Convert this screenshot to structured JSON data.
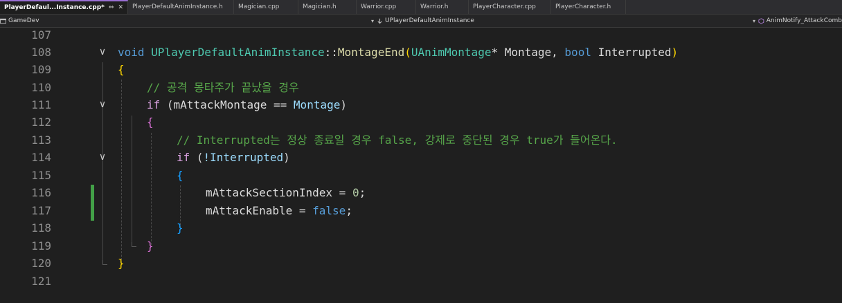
{
  "tabs": [
    {
      "label": "PlayerDefaul...Instance.cpp*",
      "active": true,
      "pin": "⇔",
      "close": "✕"
    },
    {
      "label": "PlayerDefaultAnimInstance.h"
    },
    {
      "label": "Magician.cpp"
    },
    {
      "label": "Magician.h"
    },
    {
      "label": "Warrior.cpp"
    },
    {
      "label": "Warrior.h"
    },
    {
      "label": "PlayerCharacter.cpp"
    },
    {
      "label": "PlayerCharacter.h"
    }
  ],
  "navbar": {
    "project": "GameDev",
    "scope": "UPlayerDefaultAnimInstance",
    "member": "AnimNotify_AttackComb"
  },
  "editor": {
    "line_numbers": [
      "107",
      "108",
      "109",
      "110",
      "111",
      "112",
      "113",
      "114",
      "115",
      "116",
      "117",
      "118",
      "119",
      "120",
      "121"
    ],
    "code": {
      "l108": {
        "void": "void",
        "cls": "UPlayerDefaultAnimInstance",
        "sep": "::",
        "fn": "MontageEnd",
        "p1": "(",
        "ptype": "UAnimMontage",
        "star": "* Montage, ",
        "bool": "bool",
        "rest": " Interrupted",
        "p2": ")"
      },
      "l109": "{",
      "l110": "// 공격 몽타주가 끝났을 경우",
      "l111": {
        "kw": "if",
        "open": " (",
        "var": "mAttackMontage",
        "op": " == ",
        "arg": "Montage",
        "close": ")"
      },
      "l112": "{",
      "l113": "// Interrupted는 정상 종료일 경우 false, 강제로 중단된 경우 true가 들어온다.",
      "l114": {
        "kw": "if",
        "open": " (",
        "expr": "!Interrupted",
        "close": ")"
      },
      "l115": "{",
      "l116": {
        "var": "mAttackSectionIndex",
        "op": " = ",
        "num": "0",
        "end": ";"
      },
      "l117": {
        "var": "mAttackEnable",
        "op": " = ",
        "val": "false",
        "end": ";"
      },
      "l118": "}",
      "l119": "}",
      "l120": "}"
    },
    "fold_glyph": "∨"
  }
}
